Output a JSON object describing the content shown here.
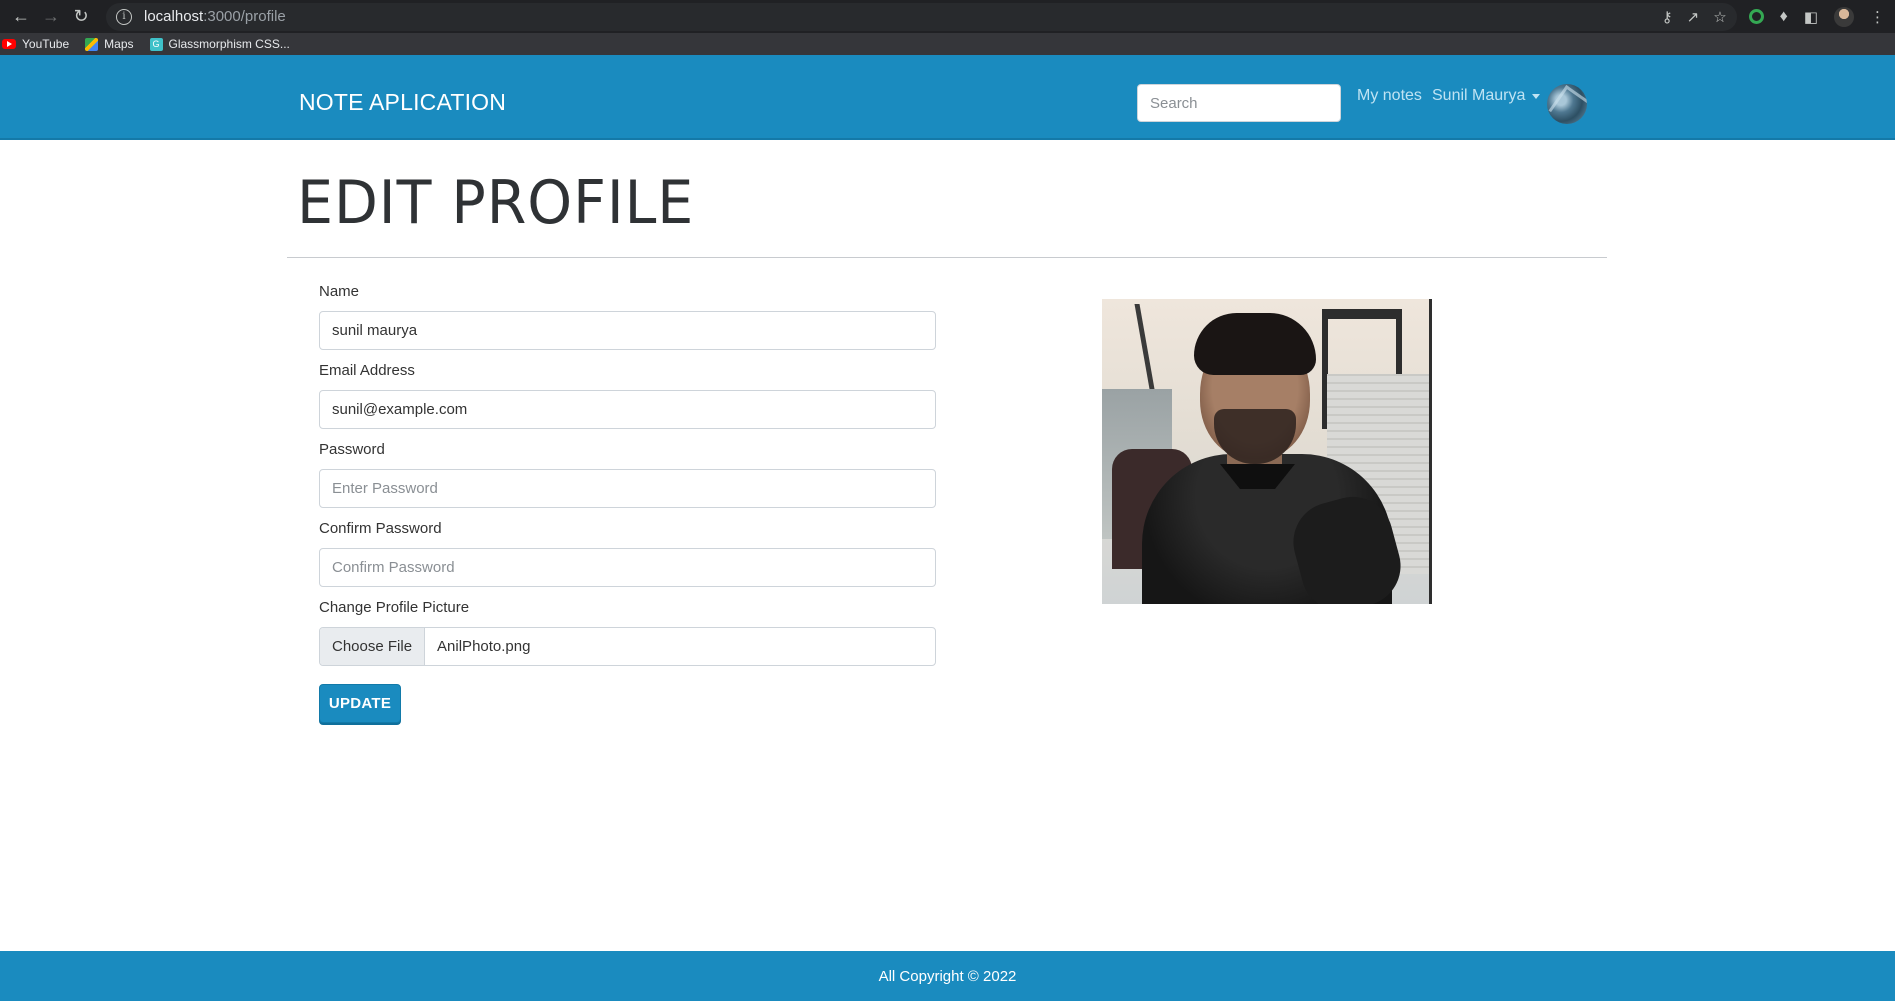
{
  "browser": {
    "url_host": "localhost",
    "url_path": ":3000/profile",
    "bookmarks": [
      {
        "label": "YouTube",
        "icon": "youtube-icon"
      },
      {
        "label": "Maps",
        "icon": "maps-icon"
      },
      {
        "label": "Glassmorphism CSS...",
        "icon": "glassmorphism-icon"
      }
    ]
  },
  "header": {
    "brand": "NOTE APLICATION",
    "search_placeholder": "Search",
    "my_notes": "My notes",
    "user_name": "Sunil Maurya"
  },
  "page": {
    "title": "EDIT PROFILE"
  },
  "form": {
    "name_label": "Name",
    "name_value": "sunil maurya",
    "email_label": "Email Address",
    "email_value": "sunil@example.com",
    "password_label": "Password",
    "password_placeholder": "Enter Password",
    "confirm_label": "Confirm Password",
    "confirm_placeholder": "Confirm Password",
    "picture_label": "Change Profile Picture",
    "file_button": "Choose File",
    "file_name": "AnilPhoto.png",
    "update_label": "UPDATE"
  },
  "footer": {
    "text": "All Copyright © 2022"
  },
  "colors": {
    "primary": "#1a8bbf",
    "chrome_dark": "#202124"
  }
}
